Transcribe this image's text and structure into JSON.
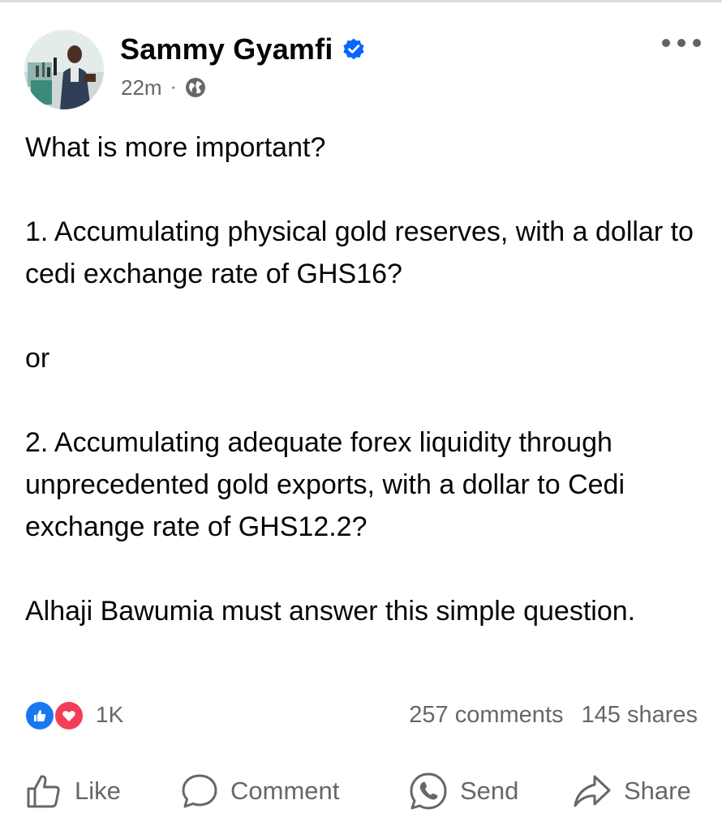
{
  "post": {
    "author": "Sammy Gyamfi",
    "timestamp": "22m",
    "separator": "·",
    "verified_icon": "verified-badge-icon",
    "privacy_icon": "globe-icon",
    "more_icon": "more-options-icon",
    "paragraphs": [
      "What is more important?",
      "1. Accumulating physical gold reserves, with a dollar to cedi exchange rate of GHS16?",
      "or",
      "2. Accumulating adequate forex liquidity through unprecedented gold exports, with a dollar to Cedi exchange rate of GHS12.2?",
      "Alhaji Bawumia must answer this simple question."
    ]
  },
  "stats": {
    "reaction_icons": [
      "like-reaction-icon",
      "love-reaction-icon"
    ],
    "reactions_count": "1K",
    "comments": "257 comments",
    "shares": "145 shares"
  },
  "actions": {
    "like": "Like",
    "comment": "Comment",
    "send": "Send",
    "share": "Share"
  },
  "colors": {
    "text": "#050505",
    "secondary": "#65676b",
    "verified": "#0866ff",
    "like": "#1877f2",
    "love": "#f33e58"
  }
}
